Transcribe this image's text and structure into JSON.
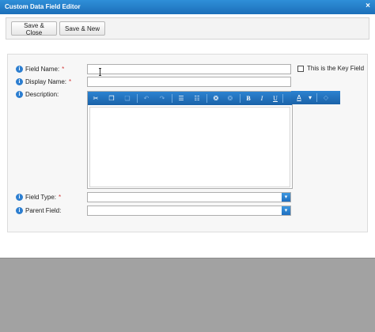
{
  "window": {
    "title": "Custom Data Field Editor",
    "close_glyph": "×"
  },
  "toolbar": {
    "save_close_label": "Save & Close",
    "save_new_label": "Save & New"
  },
  "form": {
    "required_mark": "*",
    "info_glyph": "i",
    "field_name": {
      "label": "Field Name:",
      "value": "",
      "required": true
    },
    "key_field": {
      "label": "This is the Key Field",
      "checked": false
    },
    "display_name": {
      "label": "Display Name:",
      "value": "",
      "required": true
    },
    "description": {
      "label": "Description:",
      "value": ""
    },
    "field_type": {
      "label": "Field Type:",
      "selected": "",
      "required": true
    },
    "parent_field": {
      "label": "Parent Field:",
      "selected": ""
    }
  },
  "editor_toolbar": {
    "cut": "✂",
    "copy": "❐",
    "paste": "❏",
    "undo": "↶",
    "redo": "↷",
    "numbered_list": "☰",
    "bulleted_list": "☷",
    "link": "❂",
    "unlink": "❂",
    "bold": "B",
    "italic": "I",
    "underline": "U",
    "font_color": "A",
    "font_color_dropdown": "▾",
    "eraser": "◇"
  },
  "icons": {
    "info": "info-icon",
    "select_arrow": "▾"
  },
  "colors": {
    "titlebar": "#1c6fb9",
    "editor_toolbar": "#1a62a8",
    "required": "#d23b3b",
    "backdrop": "#a2a2a2"
  }
}
